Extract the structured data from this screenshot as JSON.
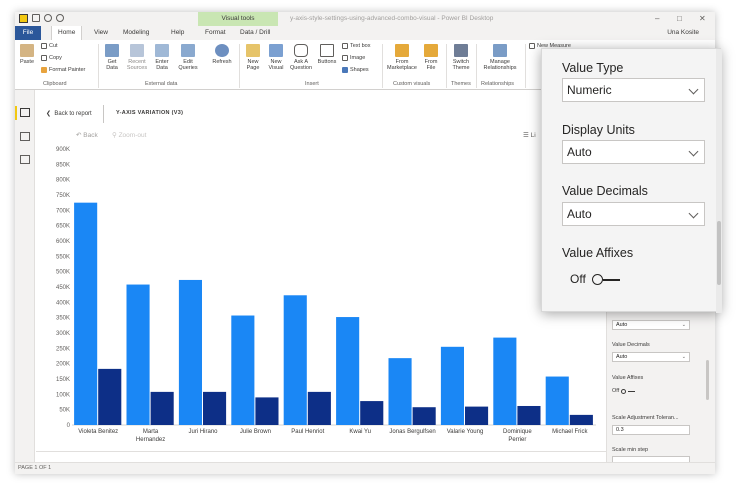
{
  "window": {
    "title": "y-axis-style-settings-using-advanced-combo-visual - Power BI Desktop",
    "context_tab": "Visual tools",
    "user": "Una Kosite"
  },
  "menu": {
    "file": "File",
    "items": [
      "Home",
      "View",
      "Modeling",
      "Help",
      "Format",
      "Data / Drill"
    ]
  },
  "ribbon": {
    "clipboard": {
      "paste": "Paste",
      "cut": "Cut",
      "copy": "Copy",
      "format_painter": "Format Painter",
      "group": "Clipboard"
    },
    "external": {
      "get_data": "Get\nData",
      "recent_sources": "Recent\nSources",
      "enter_data": "Enter\nData",
      "edit_queries": "Edit\nQueries",
      "refresh": "Refresh",
      "group": "External data"
    },
    "insert": {
      "new_page": "New\nPage",
      "new_visual": "New\nVisual",
      "ask_question": "Ask A\nQuestion",
      "buttons": "Buttons",
      "text_box": "Text box",
      "image": "Image",
      "shapes": "Shapes",
      "group": "Insert"
    },
    "custom": {
      "from_marketplace": "From\nMarketplace",
      "from_file": "From\nFile",
      "group": "Custom visuals"
    },
    "themes": {
      "switch_theme": "Switch\nTheme",
      "group": "Themes"
    },
    "relationships": {
      "manage": "Manage\nRelationships",
      "group": "Relationships"
    },
    "calculations": {
      "new_measure": "New Measure"
    }
  },
  "report": {
    "back_to_report": "Back to report",
    "visual_title": "Y-AXIS VARIATION (V3)",
    "nav_back": "Back",
    "nav_zoom": "Zoom-out",
    "legend_partial": "Li",
    "status": "PAGE 1 OF 1"
  },
  "format_pane": {
    "value_decimals_top": "Auto",
    "value_decimals_label": "Value Decimals",
    "value_decimals": "Auto",
    "value_affixes_label": "Value Affixes",
    "value_affixes_state": "Off",
    "scale_adjustment_label": "Scale Adjustment Toleran...",
    "scale_adjustment_value": "0.3",
    "scale_min_step_label": "Scale min step",
    "scale_min_step_value": ""
  },
  "zoom_panel": {
    "value_type_label": "Value Type",
    "value_type": "Numeric",
    "display_units_label": "Display Units",
    "display_units": "Auto",
    "value_decimals_label": "Value Decimals",
    "value_decimals": "Auto",
    "value_affixes_label": "Value Affixes",
    "value_affixes_state": "Off"
  },
  "colors": {
    "bar_primary": "#1a87f5",
    "bar_secondary": "#0d2f87",
    "file_tab": "#2b579a",
    "context_tab": "#c9e6b3",
    "accent": "#f2c811"
  },
  "chart_data": {
    "type": "bar",
    "categories": [
      [
        "Violeta Benitez"
      ],
      [
        "Marta",
        "Hernandez"
      ],
      [
        "Juri Hirano"
      ],
      [
        "Julie Brown"
      ],
      [
        "Paul Henriot"
      ],
      [
        "Kwai Yu"
      ],
      [
        "Jonas Bergulfsen"
      ],
      [
        "Valarie Young"
      ],
      [
        "Dominique",
        "Perrier"
      ],
      [
        "Michael Frick"
      ]
    ],
    "series": [
      {
        "values": [
          725000,
          458000,
          473000,
          357000,
          423000,
          352000,
          218000,
          255000,
          285000,
          158000
        ],
        "color": "#1a87f5"
      },
      {
        "values": [
          183000,
          108000,
          108000,
          90000,
          108000,
          78000,
          58000,
          60000,
          62000,
          33000
        ],
        "color": "#0d2f87"
      }
    ],
    "yticks": [
      "0",
      "50K",
      "100K",
      "150K",
      "200K",
      "250K",
      "300K",
      "350K",
      "400K",
      "450K",
      "500K",
      "550K",
      "600K",
      "650K",
      "700K",
      "750K",
      "800K",
      "850K",
      "900K"
    ],
    "ylim": [
      0,
      900000
    ],
    "grid": false,
    "title": "",
    "xlabel": "",
    "ylabel": ""
  }
}
